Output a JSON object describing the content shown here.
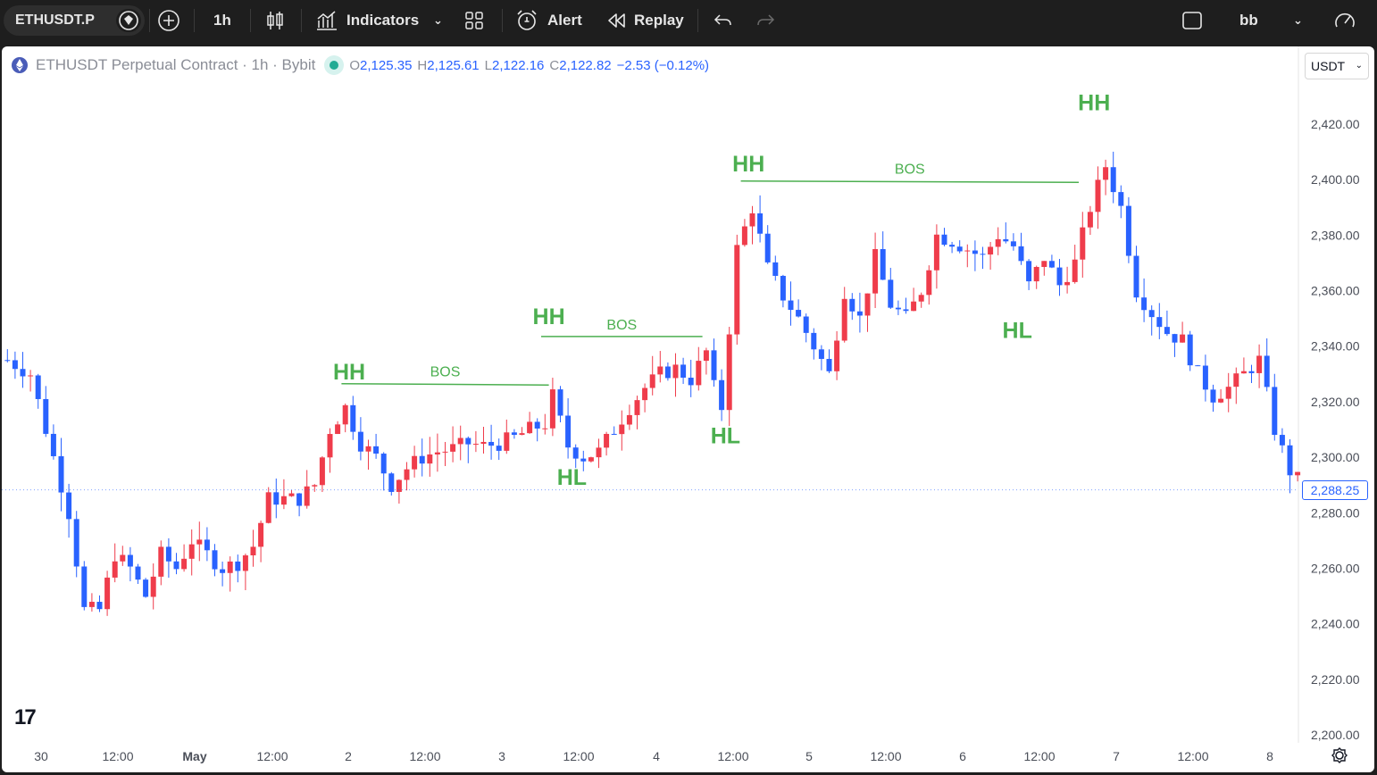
{
  "toolbar": {
    "symbol": "ETHUSDT.P",
    "interval": "1h",
    "indicators_label": "Indicators",
    "alert_label": "Alert",
    "replay_label": "Replay",
    "layout_name": "bb"
  },
  "legend": {
    "title": "ETHUSDT Perpetual Contract · 1h · Bybit",
    "o_label": "O",
    "o_value": "2,125.35",
    "h_label": "H",
    "h_value": "2,125.61",
    "l_label": "L",
    "l_value": "2,122.16",
    "c_label": "C",
    "c_value": "2,122.82",
    "change": "−2.53 (−0.12%)"
  },
  "currency": "USDT",
  "price_tag": "2,288.25",
  "logo_text": "17",
  "colors": {
    "up": "#ef3c4b",
    "down": "#2962ff",
    "marker": "#4caf50",
    "line": "#4caf50"
  },
  "chart_data": {
    "type": "candlestick",
    "y_axis": {
      "min": 2200,
      "max": 2420,
      "ticks": [
        "2,420.00",
        "2,400.00",
        "2,380.00",
        "2,360.00",
        "2,340.00",
        "2,320.00",
        "2,300.00",
        "2,280.00",
        "2,260.00",
        "2,240.00",
        "2,220.00",
        "2,200.00"
      ],
      "tick_values": [
        2420,
        2400,
        2380,
        2360,
        2340,
        2320,
        2300,
        2280,
        2260,
        2240,
        2220,
        2200
      ]
    },
    "x_axis": {
      "labels": [
        "30",
        "12:00",
        "May",
        "12:00",
        "2",
        "12:00",
        "3",
        "12:00",
        "4",
        "12:00",
        "5",
        "12:00",
        "6",
        "12:00",
        "7",
        "12:00",
        "8"
      ],
      "bold_labels": [
        "May"
      ]
    },
    "candles_count": 169,
    "markers": [
      {
        "text": "HH",
        "price": 2328,
        "bar": 45
      },
      {
        "text": "HH",
        "price": 2348,
        "bar": 71
      },
      {
        "text": "HH",
        "price": 2403,
        "bar": 97
      },
      {
        "text": "HH",
        "price": 2425,
        "bar": 142
      },
      {
        "text": "HL",
        "price": 2290,
        "bar": 74
      },
      {
        "text": "HL",
        "price": 2305,
        "bar": 94
      },
      {
        "text": "HL",
        "price": 2343,
        "bar": 132
      }
    ],
    "bos_lines": [
      {
        "label": "BOS",
        "price_start": 2326.5,
        "price_end": 2326,
        "bar_start": 44,
        "bar_end": 71
      },
      {
        "label": "BOS",
        "price_start": 2343.5,
        "price_end": 2343.5,
        "bar_start": 70,
        "bar_end": 91
      },
      {
        "label": "BOS",
        "price_start": 2399.5,
        "price_end": 2399,
        "bar_start": 96,
        "bar_end": 140
      }
    ],
    "last_price": 2288.25
  }
}
